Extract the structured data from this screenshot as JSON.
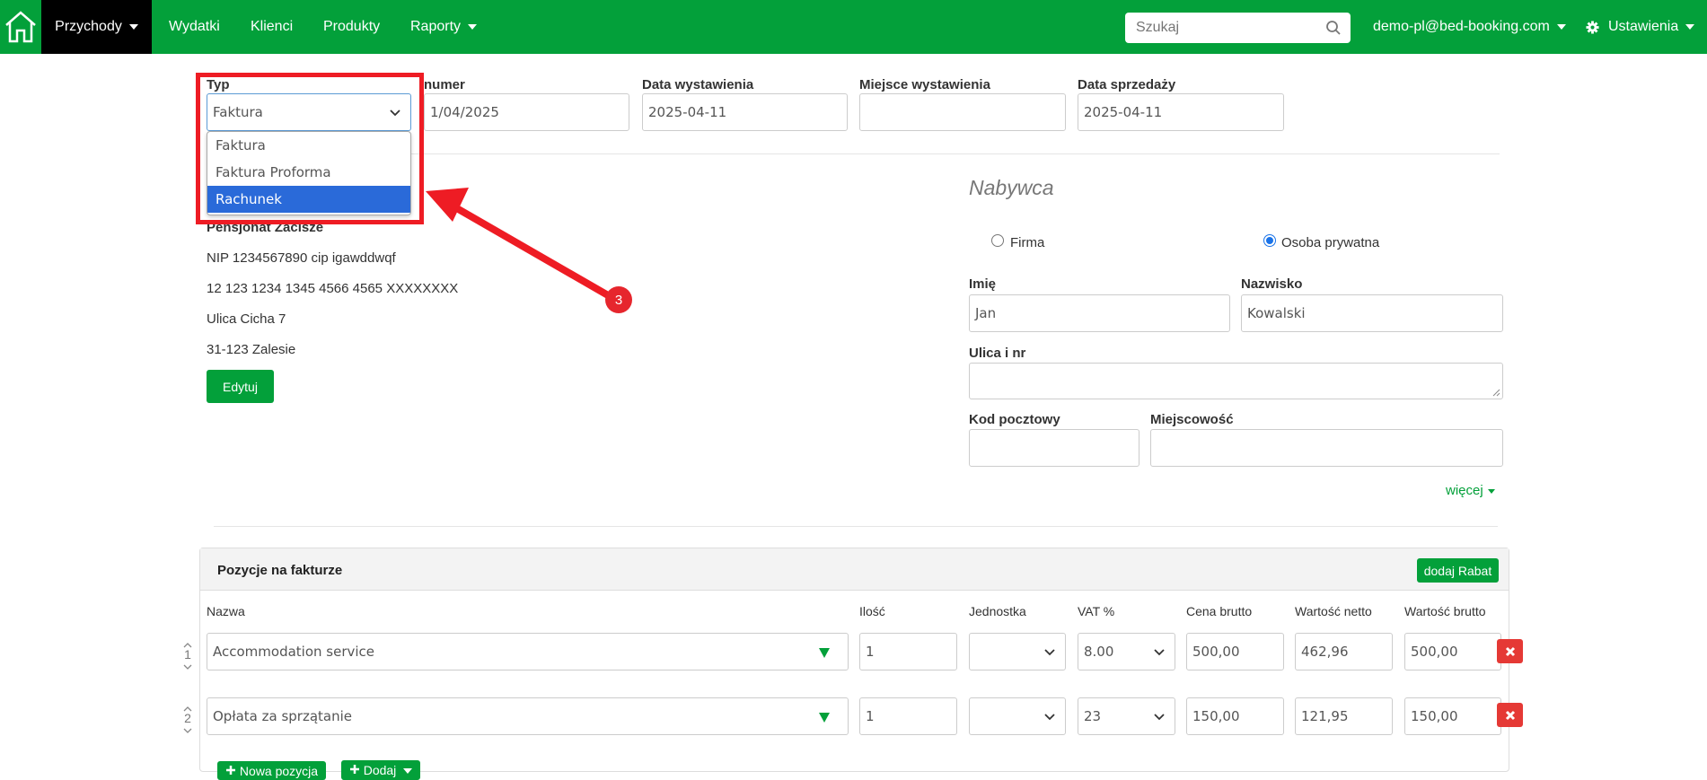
{
  "nav": {
    "home_icon": "home-icon",
    "items": [
      {
        "label": "Przychody",
        "dropdown": true,
        "active": true
      },
      {
        "label": "Wydatki"
      },
      {
        "label": "Klienci"
      },
      {
        "label": "Produkty"
      },
      {
        "label": "Raporty",
        "dropdown": true
      }
    ],
    "search_placeholder": "Szukaj",
    "user_email": "demo-pl@bed-booking.com",
    "settings_label": "Ustawienia"
  },
  "header_fields": {
    "typ": {
      "label": "Typ",
      "value": "Faktura",
      "options": [
        "Faktura",
        "Faktura Proforma",
        "Rachunek"
      ],
      "highlighted_option": "Rachunek"
    },
    "numer": {
      "label": "numer",
      "value": "1/04/2025"
    },
    "data_wystawienia": {
      "label": "Data wystawienia",
      "value": "2025-04-11"
    },
    "miejsce_wystawienia": {
      "label": "Miejsce wystawienia",
      "value": ""
    },
    "data_sprzedazy": {
      "label": "Data sprzedaży",
      "value": "2025-04-11"
    }
  },
  "annotation": {
    "step_number": "3",
    "color": "#ee1c24"
  },
  "seller": {
    "name": "Pensjonat Zacisze",
    "nip": "NIP 1234567890 cip igawddwqf",
    "account": "12 123 1234 1345 4566 4565 XXXXXXXX",
    "street": "Ulica Cicha 7",
    "city": "31-123 Zalesie",
    "edit_label": "Edytuj"
  },
  "buyer": {
    "heading": "Nabywca",
    "type_company": "Firma",
    "type_private": "Osoba prywatna",
    "selected_type": "Osoba prywatna",
    "first_name": {
      "label": "Imię",
      "value": "Jan"
    },
    "last_name": {
      "label": "Nazwisko",
      "value": "Kowalski"
    },
    "street": {
      "label": "Ulica i nr",
      "value": ""
    },
    "postal_code": {
      "label": "Kod pocztowy",
      "value": ""
    },
    "city": {
      "label": "Miejscowość",
      "value": ""
    },
    "more_label": "więcej"
  },
  "items_panel": {
    "title": "Pozycje na fakturze",
    "discount_button": "dodaj Rabat",
    "columns": [
      "Nazwa",
      "Ilość",
      "Jednostka",
      "VAT %",
      "Cena brutto",
      "Wartość netto",
      "Wartość brutto"
    ],
    "rows": [
      {
        "num": "1",
        "name": "Accommodation service",
        "qty": "1",
        "unit": "",
        "vat": "8.00",
        "price_gross": "500,00",
        "value_net": "462,96",
        "value_gross": "500,00"
      },
      {
        "num": "2",
        "name": "Opłata za sprzątanie",
        "qty": "1",
        "unit": "",
        "vat": "23",
        "price_gross": "150,00",
        "value_net": "121,95",
        "value_gross": "150,00"
      }
    ],
    "new_item_button": "Nowa pozycja",
    "add_button": "Dodaj"
  },
  "colors": {
    "brand_green": "#03a03a",
    "selected_blue": "#2a6ad9",
    "delete_red": "#e53935"
  }
}
